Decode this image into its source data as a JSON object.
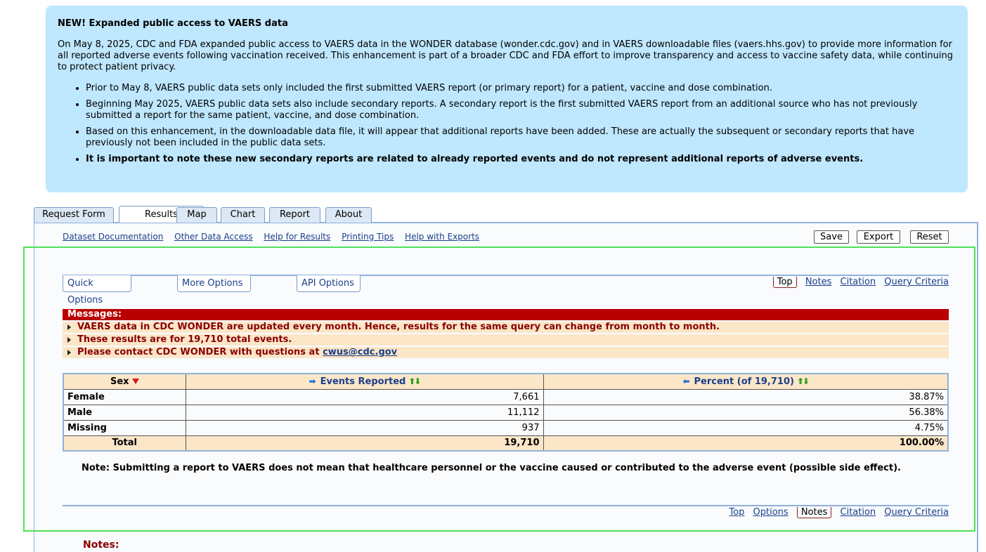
{
  "banner": {
    "title": "NEW! Expanded public access to VAERS data",
    "paragraph": "On May 8, 2025, CDC and FDA expanded public access to VAERS data in the WONDER database (wonder.cdc.gov) and in VAERS downloadable files (vaers.hhs.gov) to provide more information for all reported adverse events following vaccination received. This enhancement is part of a broader CDC and FDA effort to improve transparency and access to vaccine safety data, while continuing to protect patient privacy.",
    "bullets": [
      "Prior to May 8, VAERS public data sets only included the first submitted VAERS report (or primary report) for a patient, vaccine and dose combination.",
      "Beginning May 2025, VAERS public data sets also include secondary reports. A secondary report is the first submitted VAERS report from an additional source who has not previously submitted a report for the same patient, vaccine, and dose combination.",
      "Based on this enhancement, in the downloadable data file, it will appear that additional reports have been added. These are actually the subsequent or secondary reports that have previously not been included in the public data sets.",
      "It is important to note these new secondary reports are related to already reported events and do not represent additional reports of adverse events."
    ]
  },
  "tabs": [
    "Request Form",
    "Results",
    "Map",
    "Chart",
    "Report",
    "About"
  ],
  "links": [
    "Dataset Documentation",
    "Other Data Access",
    "Help for Results",
    "Printing Tips",
    "Help with Exports"
  ],
  "buttons": {
    "save": "Save",
    "export": "Export",
    "reset": "Reset"
  },
  "options": {
    "quick": "Quick Options",
    "more": "More Options",
    "api": "API Options"
  },
  "top_nav": {
    "top": "Top",
    "notes": "Notes",
    "citation": "Citation",
    "query": "Query Criteria"
  },
  "bottom_nav": {
    "top": "Top",
    "options": "Options",
    "notes": "Notes",
    "citation": "Citation",
    "query": "Query Criteria"
  },
  "messages": {
    "heading": "Messages:",
    "items": [
      "VAERS data in CDC WONDER are updated every month. Hence, results for the same query can change from month to month.",
      "These results are for 19,710 total events.",
      "Please contact CDC WONDER with questions at "
    ],
    "email": "cwus@cdc.gov"
  },
  "table": {
    "headers": {
      "sex": "Sex",
      "events": "Events Reported",
      "percent": "Percent (of 19,710)"
    },
    "rows": [
      {
        "sex": "Female",
        "events": "7,661",
        "percent": "38.87%"
      },
      {
        "sex": "Male",
        "events": "11,112",
        "percent": "56.38%"
      },
      {
        "sex": "Missing",
        "events": "937",
        "percent": "4.75%"
      }
    ],
    "total": {
      "label": "Total",
      "events": "19,710",
      "percent": "100.00%"
    }
  },
  "note": "Note: Submitting a report to VAERS does not mean that healthcare personnel or the vaccine caused or contributed to the adverse event (possible side effect).",
  "notes_title": "Notes:"
}
